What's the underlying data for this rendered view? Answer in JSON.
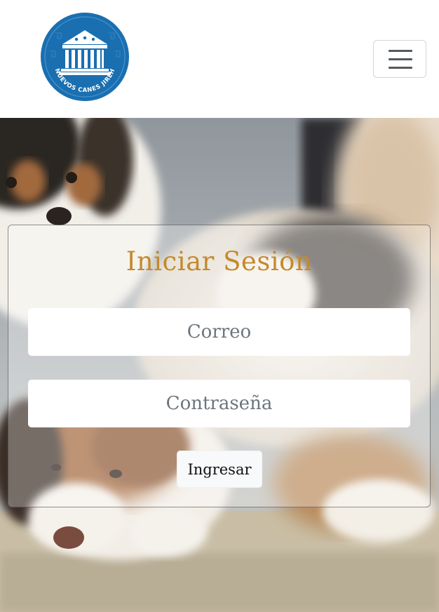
{
  "header": {
    "logo": {
      "icon": "temple-paws-logo",
      "text": "NUEVOS CANES JIREH",
      "color": "#1a6fb0"
    },
    "menu_icon": "hamburger-icon"
  },
  "hero": {
    "background": "puppies-photo"
  },
  "login": {
    "title": "Iniciar Sesión",
    "email_placeholder": "Correo",
    "password_placeholder": "Contraseña",
    "submit_label": "Ingresar",
    "title_color": "#c58a2c"
  }
}
